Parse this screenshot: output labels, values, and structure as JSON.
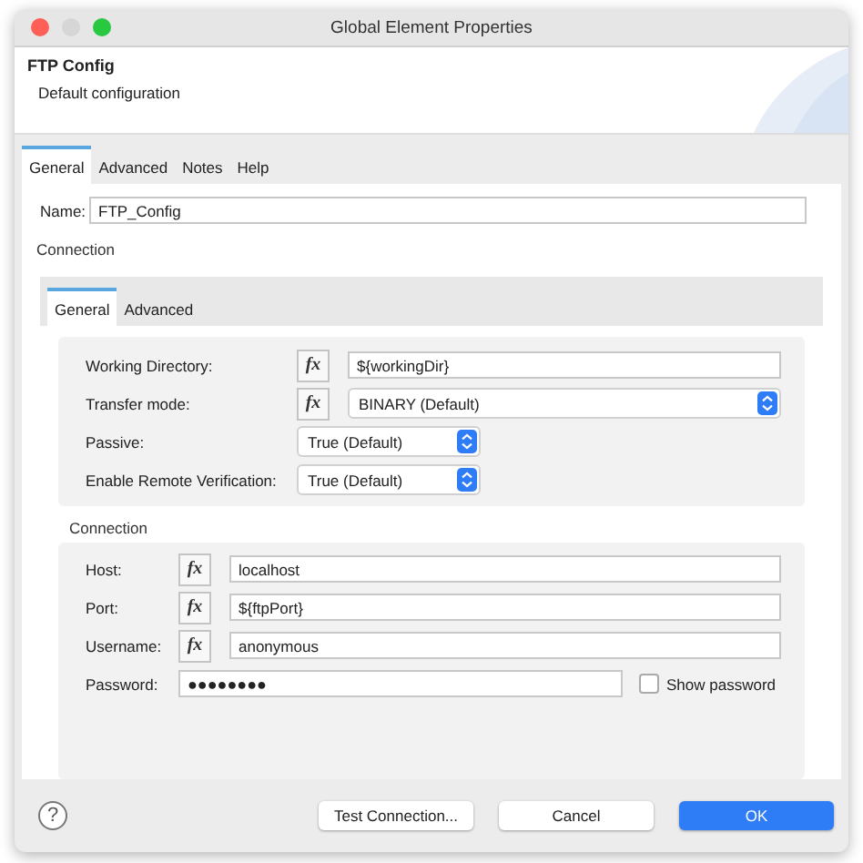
{
  "window": {
    "title": "Global Element Properties",
    "buttons": [
      {
        "kind": "close",
        "disabled": false
      },
      {
        "kind": "minimize",
        "disabled": true
      },
      {
        "kind": "zoom",
        "disabled": false
      }
    ]
  },
  "header": {
    "title": "FTP Config",
    "subtitle": "Default configuration"
  },
  "tabs": [
    {
      "label": "General",
      "selected": true
    },
    {
      "label": "Advanced",
      "selected": false
    },
    {
      "label": "Notes",
      "selected": false
    },
    {
      "label": "Help",
      "selected": false
    }
  ],
  "name_field": {
    "label": "Name:",
    "value": "FTP_Config"
  },
  "section_label": "Connection",
  "inner_tabs": [
    {
      "label": "General",
      "selected": true
    },
    {
      "label": "Advanced",
      "selected": false
    }
  ],
  "settings": [
    {
      "kind": "text",
      "label": "Working Directory:",
      "expression": "fx",
      "value": "${workingDir}"
    },
    {
      "kind": "select",
      "label": "Transfer mode:",
      "expression": "fx",
      "value": "BINARY (Default)"
    },
    {
      "kind": "select",
      "label": "Passive:",
      "value": "True (Default)"
    },
    {
      "kind": "select",
      "label": "Enable Remote Verification:",
      "value": "True (Default)"
    }
  ],
  "connection": {
    "title": "Connection",
    "rows": [
      {
        "kind": "text",
        "label": "Host:",
        "expression": "fx",
        "value": "localhost"
      },
      {
        "kind": "text",
        "label": "Port:",
        "expression": "fx",
        "value": "${ftpPort}"
      },
      {
        "kind": "text",
        "label": "Username:",
        "expression": "fx",
        "value": "anonymous"
      },
      {
        "kind": "password",
        "label": "Password:",
        "value": "●●●●●●●●",
        "checkbox": {
          "label": "Show password",
          "checked": false
        }
      }
    ]
  },
  "footer": {
    "help": "?",
    "buttons": [
      {
        "label": "Test Connection...",
        "kind": "default"
      },
      {
        "label": "Cancel",
        "kind": "default"
      },
      {
        "label": "OK",
        "kind": "primary"
      }
    ]
  }
}
